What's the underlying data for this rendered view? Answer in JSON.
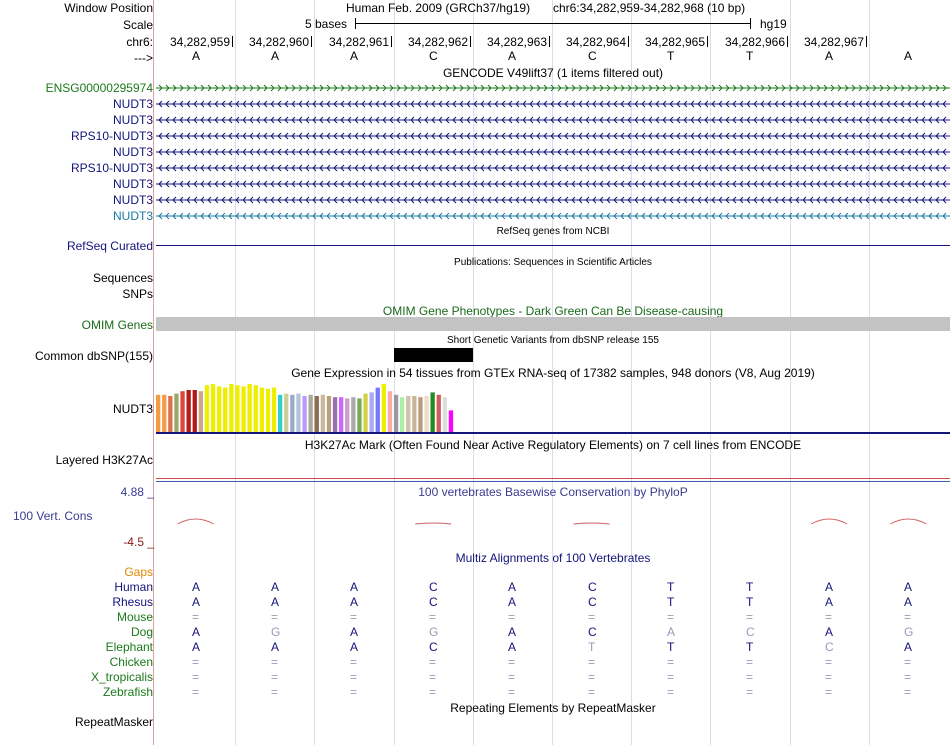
{
  "header": {
    "window_position_label": "Window Position",
    "scale_label": "Scale",
    "chrom_label": "chr6:",
    "strand_label": "--->",
    "assembly": "Human Feb. 2009 (GRCh37/hg19)",
    "position": "chr6:34,282,959-34,282,968 (10 bp)",
    "scale_text": "5 bases",
    "db": "hg19",
    "coords": [
      "34,282,959",
      "34,282,960",
      "34,282,961",
      "34,282,962",
      "34,282,963",
      "34,282,964",
      "34,282,965",
      "34,282,966",
      "34,282,967"
    ],
    "bases": [
      "A",
      "A",
      "A",
      "C",
      "A",
      "C",
      "T",
      "T",
      "A",
      "A"
    ]
  },
  "gencode": {
    "title": "GENCODE V49lift37 (1 items filtered out)",
    "tracks": [
      {
        "label": "ENSG00000295974",
        "color": "#1a7a1a",
        "strand": "+"
      },
      {
        "label": "NUDT3",
        "color": "#14147a",
        "strand": "-"
      },
      {
        "label": "NUDT3",
        "color": "#14147a",
        "strand": "-"
      },
      {
        "label": "RPS10-NUDT3",
        "color": "#14147a",
        "strand": "-"
      },
      {
        "label": "NUDT3",
        "color": "#14147a",
        "strand": "-"
      },
      {
        "label": "RPS10-NUDT3",
        "color": "#14147a",
        "strand": "-"
      },
      {
        "label": "NUDT3",
        "color": "#14147a",
        "strand": "-"
      },
      {
        "label": "NUDT3",
        "color": "#14147a",
        "strand": "-"
      },
      {
        "label": "NUDT3",
        "color": "#1a7aa0",
        "strand": "-"
      }
    ]
  },
  "refseq": {
    "title": "RefSeq genes from NCBI",
    "label": "RefSeq Curated"
  },
  "publications": {
    "title": "Publications: Sequences in Scientific Articles",
    "sequences_label": "Sequences",
    "snps_label": "SNPs"
  },
  "omim": {
    "title": "OMIM Gene Phenotypes - Dark Green Can Be Disease-causing",
    "label": "OMIM Genes"
  },
  "dbsnp": {
    "title": "Short Genetic Variants from dbSNP release 155",
    "label": "Common dbSNP(155)"
  },
  "gtex": {
    "title": "Gene Expression in 54 tissues from GTEx RNA-seq of 17382 samples, 948 donors (V8, Aug 2019)",
    "label": "NUDT3",
    "bars": [
      {
        "h": 0.62,
        "c": "#f39c45"
      },
      {
        "h": 0.62,
        "c": "#f39c45"
      },
      {
        "h": 0.6,
        "c": "#e0704a"
      },
      {
        "h": 0.64,
        "c": "#9aa96a"
      },
      {
        "h": 0.68,
        "c": "#e0453d"
      },
      {
        "h": 0.7,
        "c": "#b31b1b"
      },
      {
        "h": 0.7,
        "c": "#b31b1b"
      },
      {
        "h": 0.68,
        "c": "#c8a98e"
      },
      {
        "h": 0.78,
        "c": "#eeee00"
      },
      {
        "h": 0.8,
        "c": "#eeee00"
      },
      {
        "h": 0.76,
        "c": "#eeee00"
      },
      {
        "h": 0.74,
        "c": "#eeee00"
      },
      {
        "h": 0.8,
        "c": "#eeee00"
      },
      {
        "h": 0.78,
        "c": "#eeee00"
      },
      {
        "h": 0.76,
        "c": "#eeee00"
      },
      {
        "h": 0.8,
        "c": "#eeee00"
      },
      {
        "h": 0.78,
        "c": "#eeee00"
      },
      {
        "h": 0.74,
        "c": "#eeee00"
      },
      {
        "h": 0.72,
        "c": "#eeee00"
      },
      {
        "h": 0.74,
        "c": "#eeee00"
      },
      {
        "h": 0.62,
        "c": "#33cccc"
      },
      {
        "h": 0.64,
        "c": "#cccc99"
      },
      {
        "h": 0.62,
        "c": "#99aacc"
      },
      {
        "h": 0.64,
        "c": "#b0c4de"
      },
      {
        "h": 0.6,
        "c": "#bb99ff"
      },
      {
        "h": 0.62,
        "c": "#aaaa99"
      },
      {
        "h": 0.6,
        "c": "#8b6f4e"
      },
      {
        "h": 0.62,
        "c": "#cdb79e"
      },
      {
        "h": 0.6,
        "c": "#b8a07a"
      },
      {
        "h": 0.58,
        "c": "#9a6fb0"
      },
      {
        "h": 0.58,
        "c": "#cc66ff"
      },
      {
        "h": 0.56,
        "c": "#c8a0c8"
      },
      {
        "h": 0.58,
        "c": "#aaaaaa"
      },
      {
        "h": 0.56,
        "c": "#77aa55"
      },
      {
        "h": 0.64,
        "c": "#d2d248"
      },
      {
        "h": 0.66,
        "c": "#aaaaee"
      },
      {
        "h": 0.74,
        "c": "#7777ff"
      },
      {
        "h": 0.8,
        "c": "#eeee00"
      },
      {
        "h": 0.68,
        "c": "#ffaaaa"
      },
      {
        "h": 0.62,
        "c": "#999999"
      },
      {
        "h": 0.58,
        "c": "#aaeeaa"
      },
      {
        "h": 0.6,
        "c": "#d2c0a8"
      },
      {
        "h": 0.6,
        "c": "#c7b49b"
      },
      {
        "h": 0.58,
        "c": "#b79b7a"
      },
      {
        "h": 0.6,
        "c": "#eedcc8"
      },
      {
        "h": 0.66,
        "c": "#228b22"
      },
      {
        "h": 0.62,
        "c": "#cd5c5c"
      },
      {
        "h": 0.58,
        "c": "#dddddd"
      },
      {
        "h": 0.36,
        "c": "#ff00ff"
      }
    ]
  },
  "h3k27ac": {
    "title": "H3K27Ac Mark (Often Found Near Active Regulatory Elements) on 7 cell lines from ENCODE",
    "label": "Layered H3K27Ac"
  },
  "phylop": {
    "title": "100 vertebrates Basewise Conservation by PhyloP",
    "label": "100 Vert. Cons",
    "max": "4.88 _",
    "min": "-4.5 _",
    "peaks": [
      1,
      0,
      0,
      0.2,
      0,
      0.2,
      0,
      0,
      1,
      1
    ],
    "baseline_color": "#d06060"
  },
  "multiz": {
    "title": "Multiz Alignments of 100 Vertebrates",
    "gaps_label": "Gaps",
    "species": [
      {
        "name": "Human",
        "color": "#14147a",
        "seq": [
          "A",
          "A",
          "A",
          "C",
          "A",
          "C",
          "T",
          "T",
          "A",
          "A"
        ],
        "faint": [
          0,
          0,
          0,
          0,
          0,
          0,
          0,
          0,
          0,
          0
        ]
      },
      {
        "name": "Rhesus",
        "color": "#14147a",
        "seq": [
          "A",
          "A",
          "A",
          "C",
          "A",
          "C",
          "T",
          "T",
          "A",
          "A"
        ],
        "faint": [
          0,
          0,
          0,
          0,
          0,
          0,
          0,
          0,
          0,
          0
        ]
      },
      {
        "name": "Mouse",
        "color": "#1a7a1a",
        "seq": [
          "=",
          "=",
          "=",
          "=",
          "=",
          "=",
          "=",
          "=",
          "=",
          "="
        ],
        "faint": [
          1,
          1,
          1,
          1,
          1,
          1,
          1,
          1,
          1,
          1
        ]
      },
      {
        "name": "Dog",
        "color": "#1a7a1a",
        "seq": [
          "A",
          "G",
          "A",
          "G",
          "A",
          "C",
          "A",
          "C",
          "A",
          "G"
        ],
        "faint": [
          0,
          1,
          0,
          1,
          0,
          0,
          1,
          1,
          0,
          1
        ]
      },
      {
        "name": "Elephant",
        "color": "#1a7a1a",
        "seq": [
          "A",
          "A",
          "A",
          "C",
          "A",
          "T",
          "T",
          "T",
          "C",
          "A"
        ],
        "faint": [
          0,
          0,
          0,
          0,
          0,
          1,
          0,
          0,
          1,
          0
        ]
      },
      {
        "name": "Chicken",
        "color": "#1a7a1a",
        "seq": [
          "=",
          "=",
          "=",
          "=",
          "=",
          "=",
          "=",
          "=",
          "=",
          "="
        ],
        "faint": [
          1,
          1,
          1,
          1,
          1,
          1,
          1,
          1,
          1,
          1
        ]
      },
      {
        "name": "X_tropicalis",
        "color": "#1a7a1a",
        "seq": [
          "=",
          "=",
          "=",
          "=",
          "=",
          "=",
          "=",
          "=",
          "=",
          "="
        ],
        "faint": [
          1,
          1,
          1,
          1,
          1,
          1,
          1,
          1,
          1,
          1
        ]
      },
      {
        "name": "Zebrafish",
        "color": "#1a7a1a",
        "seq": [
          "=",
          "=",
          "=",
          "=",
          "=",
          "=",
          "=",
          "=",
          "=",
          "="
        ],
        "faint": [
          1,
          1,
          1,
          1,
          1,
          1,
          1,
          1,
          1,
          1
        ]
      }
    ]
  },
  "repeatmasker": {
    "title": "Repeating Elements by RepeatMasker",
    "label": "RepeatMasker"
  }
}
